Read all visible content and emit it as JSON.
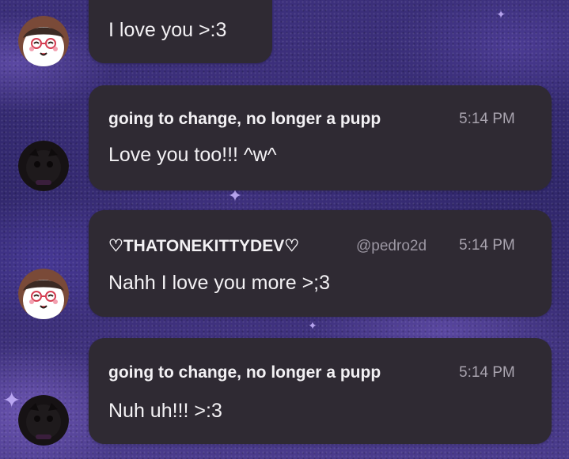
{
  "messages": [
    {
      "text": "I love you >:3",
      "avatar": "beaver-avatar"
    },
    {
      "author": "going to change, no longer a pupp",
      "time": "5:14 PM",
      "text": "Love you too!!! ^w^",
      "avatar": "dark-avatar"
    },
    {
      "author": "♡THATONEKITTYDEV♡",
      "handle": "@pedro2d",
      "time": "5:14 PM",
      "text": "Nahh I love you more >;3",
      "avatar": "beaver-avatar"
    },
    {
      "author": "going to change, no longer a pupp",
      "time": "5:14 PM",
      "text": "Nuh uh!!! >:3",
      "avatar": "dark-avatar"
    }
  ],
  "colors": {
    "bubble": "#2f2a33",
    "text": "#f3f1f4",
    "muted": "#a8a3ae",
    "background": "#30276b"
  },
  "decorations": [
    "sparkle-icon",
    "sparkle-icon",
    "sparkle-icon",
    "sparkle-icon"
  ]
}
